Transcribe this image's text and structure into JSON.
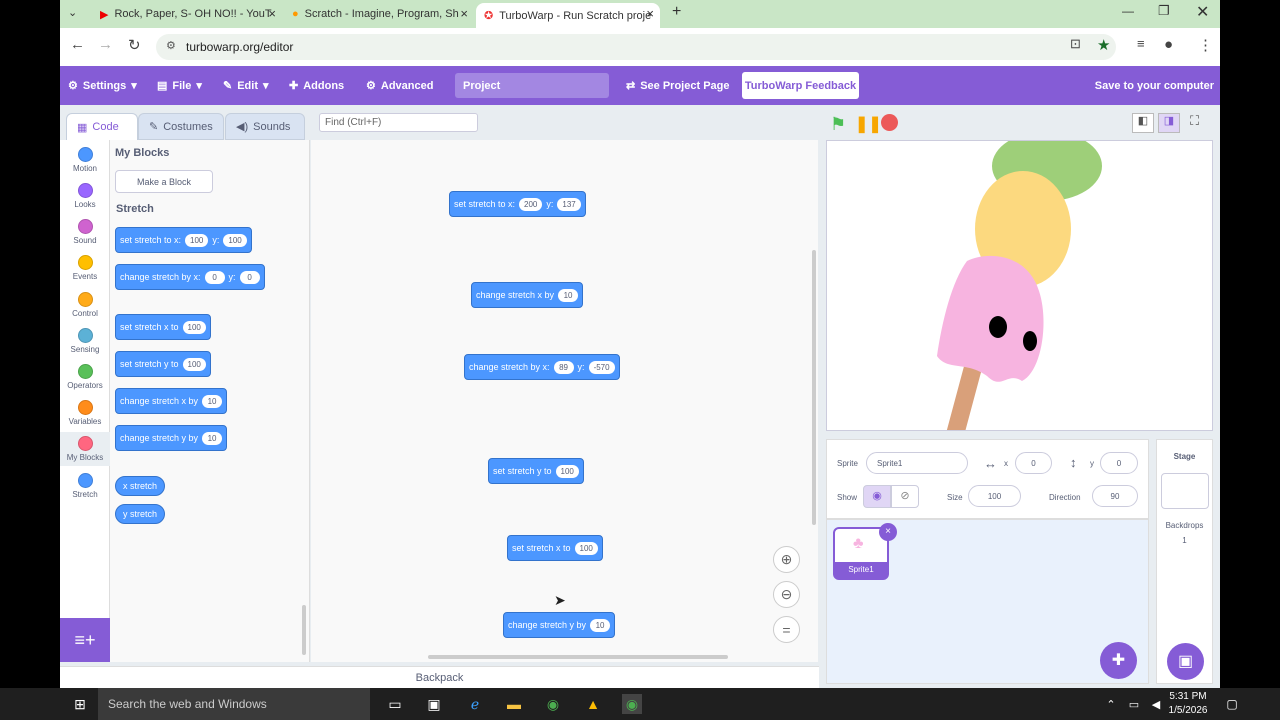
{
  "browser": {
    "tabs": [
      {
        "title": "Rock, Paper, S- OH NO!! - YouT"
      },
      {
        "title": "Scratch - Imagine, Program, Sh"
      },
      {
        "title": "TurboWarp - Run Scratch proje"
      }
    ],
    "url": "turbowarp.org/editor"
  },
  "menu": {
    "settings": "Settings",
    "file": "File",
    "edit": "Edit",
    "addons": "Addons",
    "advanced": "Advanced",
    "project_title": "Project",
    "see_project_page": "See Project Page",
    "feedback": "TurboWarp Feedback",
    "save": "Save to your computer"
  },
  "editor_tabs": {
    "code": "Code",
    "costumes": "Costumes",
    "sounds": "Sounds"
  },
  "find_placeholder": "Find (Ctrl+F)",
  "categories": [
    {
      "label": "Motion",
      "color": "#4c97ff"
    },
    {
      "label": "Looks",
      "color": "#9966ff"
    },
    {
      "label": "Sound",
      "color": "#cf63cf"
    },
    {
      "label": "Events",
      "color": "#ffbf00"
    },
    {
      "label": "Control",
      "color": "#ffab19"
    },
    {
      "label": "Sensing",
      "color": "#5cb1d6"
    },
    {
      "label": "Operators",
      "color": "#59c059"
    },
    {
      "label": "Variables",
      "color": "#ff8c1a"
    },
    {
      "label": "My Blocks",
      "color": "#ff6680"
    },
    {
      "label": "Stretch",
      "color": "#4c97ff"
    }
  ],
  "palette": {
    "my_blocks_heading": "My Blocks",
    "make_block": "Make a Block",
    "stretch_heading": "Stretch",
    "blocks": [
      {
        "text": "set stretch to x:",
        "a": "100",
        "mid": "y:",
        "b": "100"
      },
      {
        "text": "change stretch by x:",
        "a": "0",
        "mid": "y:",
        "b": "0"
      },
      {
        "text": "set stretch x to",
        "a": "100"
      },
      {
        "text": "set stretch y to",
        "a": "100"
      },
      {
        "text": "change stretch x by",
        "a": "10"
      },
      {
        "text": "change stretch y by",
        "a": "10"
      }
    ],
    "reporters": [
      "x stretch",
      "y stretch"
    ]
  },
  "workspace": {
    "blocks": [
      {
        "text": "set stretch to x:",
        "a": "200",
        "mid": "y:",
        "b": "137"
      },
      {
        "text": "change stretch x by",
        "a": "10"
      },
      {
        "text": "change stretch by x:",
        "a": "89",
        "mid": "y:",
        "b": "-570"
      },
      {
        "text": "set stretch y to",
        "a": "100"
      },
      {
        "text": "set stretch x to",
        "a": "100"
      },
      {
        "text": "change stretch y by",
        "a": "10"
      }
    ]
  },
  "sprite_info": {
    "sprite_label": "Sprite",
    "sprite_name": "Sprite1",
    "x_label": "x",
    "x": "0",
    "y_label": "y",
    "y": "0",
    "show_label": "Show",
    "size_label": "Size",
    "size": "100",
    "direction_label": "Direction",
    "direction": "90"
  },
  "sprite_tile": {
    "name": "Sprite1"
  },
  "stage_pane": {
    "title": "Stage",
    "backdrops_label": "Backdrops",
    "backdrops_count": "1"
  },
  "backpack": "Backpack",
  "taskbar": {
    "search": "Search the web and Windows",
    "time": "5:31 PM",
    "date": "1/5/2026"
  }
}
